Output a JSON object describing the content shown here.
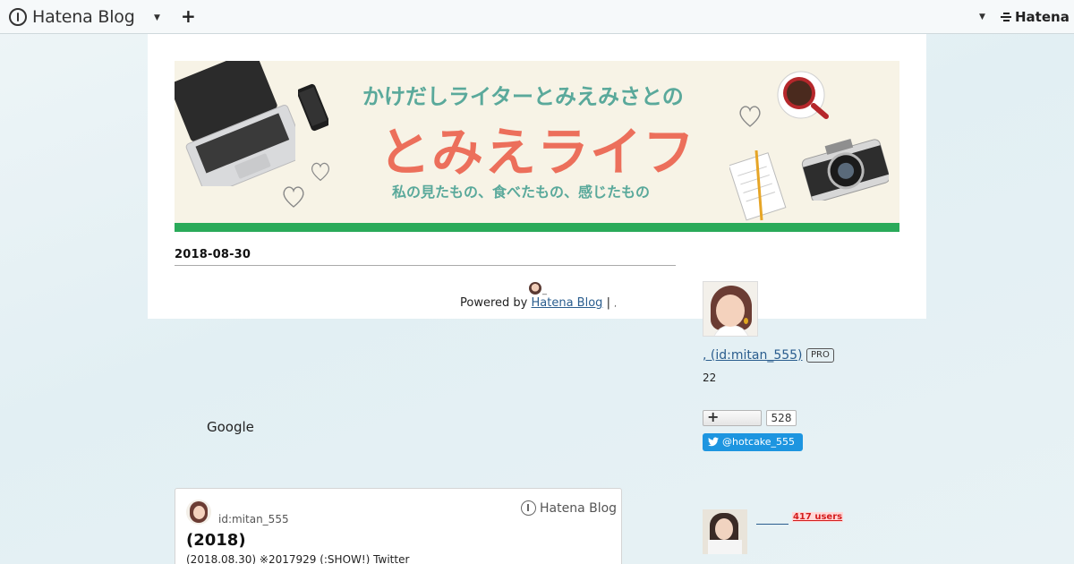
{
  "topbar": {
    "logo_text": "Hatena Blog",
    "add_label": "+",
    "right_logo_text": "Hatena"
  },
  "header": {
    "tagline": "かけだしライターとみえみさとの",
    "title": "とみえライフ",
    "subtitle": "私の見たもの、食べたもの、感じたもの",
    "accent_color": "#2aaa59",
    "title_color": "#ec6f5b",
    "tagline_color": "#5aa99b"
  },
  "post": {
    "date": "2018-08-30"
  },
  "footer": {
    "powered_prefix": "Powered by",
    "powered_link": "Hatena Blog",
    "separator": "|",
    "trailing": ","
  },
  "sidebar": {
    "profile_name": ", (id:mitan_555)",
    "pro_badge": "PRO",
    "count": "22",
    "follow_label": "+",
    "follower_count": "528",
    "twitter_handle": "@hotcake_555",
    "follower_users": "417 users"
  },
  "ad": {
    "label": "Google"
  },
  "card": {
    "user": "id:mitan_555",
    "logo_text": "Hatena Blog",
    "title": "(2018)",
    "description": "(2018.08.30) ※2017929  (:SHOW!) Twitter"
  }
}
